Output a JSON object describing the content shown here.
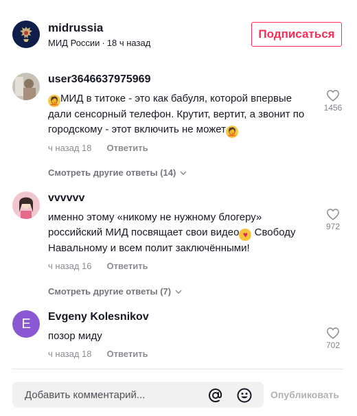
{
  "post": {
    "author": "midrussia",
    "author_display": "МИД России",
    "separator": "·",
    "time": "18 ч назад",
    "follow_label": "Подписаться"
  },
  "comments": [
    {
      "user": "user3646637975969",
      "text_part1": "МИД в титоке - это как бабуля, которой впервые дали сенсорный телефон. Крутит, вертит, а звонит по городскому - этот включить не может",
      "emoji_1": "facepalm-emoji",
      "emoji_2": "facepalm-emoji",
      "time": "ч назад 18",
      "reply_label": "Ответить",
      "likes": "1456",
      "more_replies": "Смотреть другие ответы (14)"
    },
    {
      "user": "vvvvvv",
      "text_part1": "именно этому «никому не нужному блогеру» российский МИД посвящает свои видео",
      "text_part2": " Свободу Навальному и всем полит заключёнными!",
      "emoji_1": "smiling-face-with-hearts-emoji",
      "time": "ч назад 16",
      "reply_label": "Ответить",
      "likes": "972",
      "more_replies": "Смотреть другие ответы (7)"
    },
    {
      "user": "Evgeny Kolesnikov",
      "avatar_letter": "E",
      "text_part1": "позор миду",
      "time": "ч назад 18",
      "reply_label": "Ответить",
      "likes": "702"
    }
  ],
  "composer": {
    "placeholder": "Добавить комментарий...",
    "post_label": "Опубликовать"
  },
  "colors": {
    "accent": "#fe2c55",
    "text": "#161823",
    "avatar_purple": "#8a58d3"
  }
}
